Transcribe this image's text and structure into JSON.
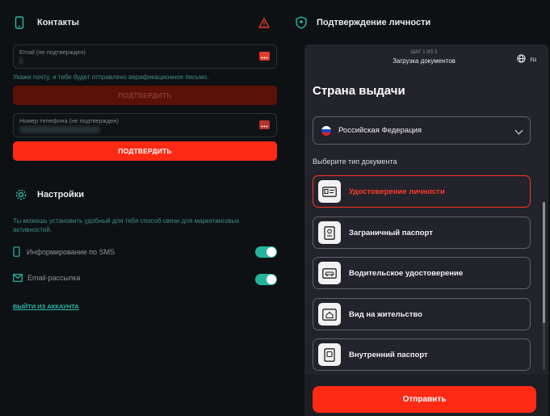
{
  "contacts": {
    "title": "Контакты",
    "email_label": "Email (не подтвержден)",
    "email_hint": "Укажи почту, и тебе будет отправлено верификационное письмо.",
    "confirm_email_label": "ПОДТВЕРДИТЬ",
    "phone_label": "Номер телефона (не подтвержден)",
    "confirm_phone_label": "ПОДТВЕРДИТЬ"
  },
  "settings": {
    "title": "Настройки",
    "description": "Ты можешь установить удобный для тебя способ связи для маркетинговых активностей.",
    "items": [
      {
        "label": "Информирование по SMS",
        "enabled": true
      },
      {
        "label": "Email-рассылка",
        "enabled": true
      }
    ],
    "logout_label": "ВЫЙТИ ИЗ АККАУНТА"
  },
  "verification": {
    "title": "Подтверждение личности"
  },
  "modal": {
    "step": "ШАГ 1 ИЗ 3",
    "step_title": "Загрузка документов",
    "language": "ru",
    "heading": "Страна выдачи",
    "country": "Российская Федерация",
    "doc_prompt": "Выберите тип документа",
    "documents": [
      {
        "label": "Удостоверение личности",
        "icon": "id-card-icon",
        "selected": true
      },
      {
        "label": "Заграничный паспорт",
        "icon": "passport-icon",
        "selected": false
      },
      {
        "label": "Водительское удостоверение",
        "icon": "car-license-icon",
        "selected": false
      },
      {
        "label": "Вид на жительство",
        "icon": "residence-home-icon",
        "selected": false
      },
      {
        "label": "Внутренний паспорт",
        "icon": "internal-passport-icon",
        "selected": false
      }
    ],
    "submit_label": "Отправить"
  },
  "colors": {
    "accent_red": "#ff2a14",
    "teal": "#2ab8a8",
    "background": "#0e1113",
    "modal_bg": "#23232b"
  }
}
